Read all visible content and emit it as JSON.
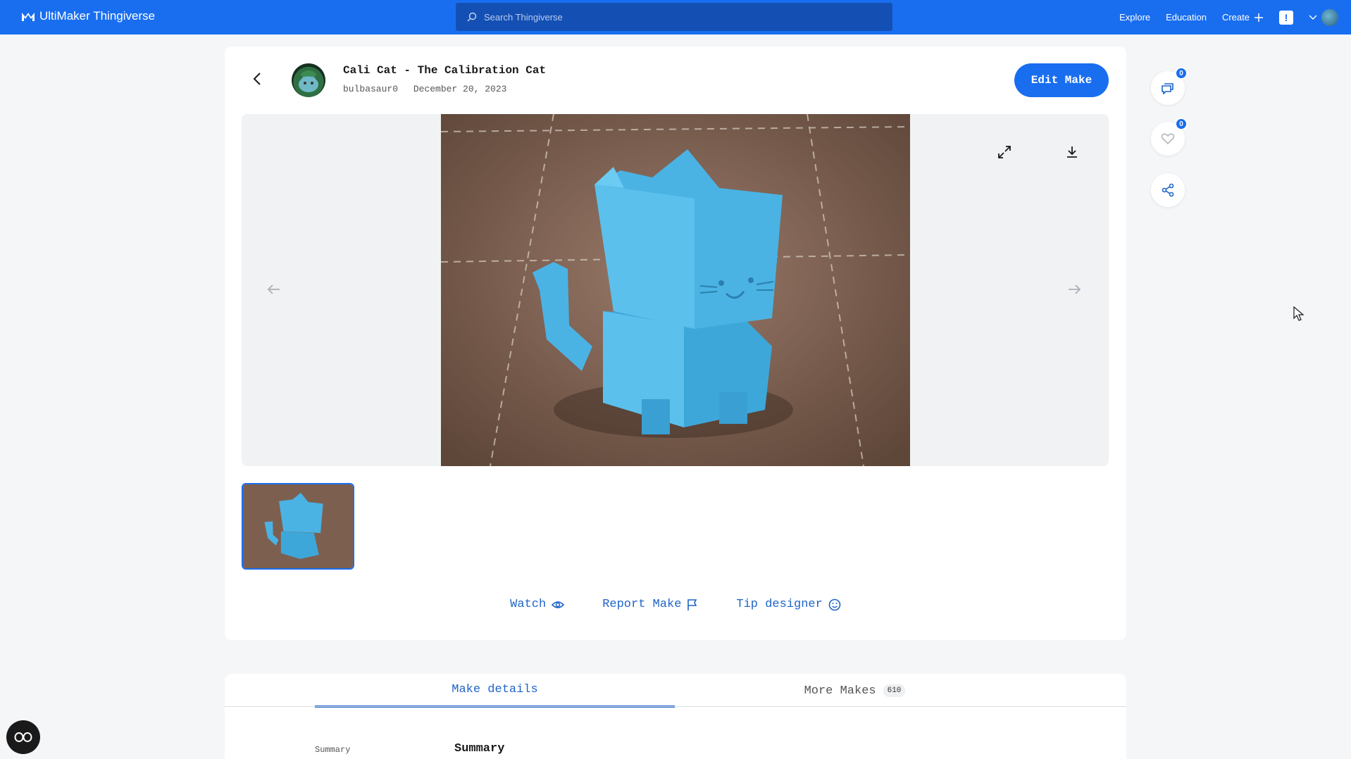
{
  "header": {
    "brand": "UltiMaker Thingiverse",
    "search_placeholder": "Search Thingiverse",
    "nav": {
      "explore": "Explore",
      "education": "Education",
      "create": "Create",
      "alert": "!"
    }
  },
  "make": {
    "title": "Cali Cat - The Calibration Cat",
    "author": "bulbasaur0",
    "date": "December 20, 2023",
    "edit_label": "Edit Make"
  },
  "actions": {
    "watch": "Watch",
    "report": "Report Make",
    "tip": "Tip designer"
  },
  "tabs": {
    "details": "Make details",
    "more": "More Makes",
    "more_count": "610"
  },
  "details": {
    "side_label": "Summary",
    "section_title": "Summary"
  },
  "social": {
    "comments_count": "0",
    "likes_count": "0"
  },
  "colors": {
    "accent": "#196ef0",
    "link": "#1f64c8",
    "cat_blue": "#4ab3e4"
  },
  "icons": [
    "search-icon",
    "plus-icon",
    "chevron-down-icon",
    "back-arrow-icon",
    "expand-icon",
    "download-icon",
    "arrow-left-icon",
    "arrow-right-icon",
    "eye-icon",
    "flag-icon",
    "smile-icon",
    "comment-icon",
    "heart-icon",
    "share-icon",
    "cookie-settings-icon"
  ]
}
